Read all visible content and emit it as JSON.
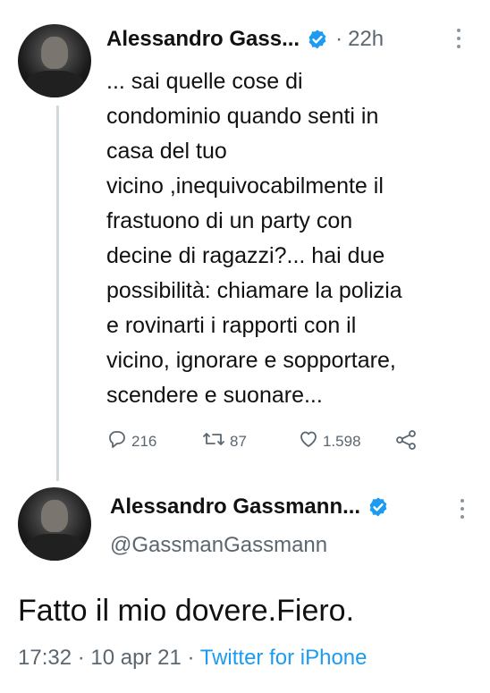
{
  "tweet1": {
    "author_name": "Alessandro Gass...",
    "time_ago": "22h",
    "separator": "·",
    "text": "... sai quelle cose di\ncondominio quando senti in\ncasa del tuo\nvicino ,inequivocabilmente il\nfrastuono di un party con\ndecine di ragazzi?... hai due\npossibilità: chiamare la polizia\ne rovinarti i rapporti con il\nvicino, ignorare e sopportare,\nscendere e suonare...",
    "replies": "216",
    "retweets": "87",
    "likes": "1.598",
    "icons": {
      "reply": "reply-icon",
      "retweet": "retweet-icon",
      "like": "heart-icon",
      "share": "share-icon",
      "more": "more-vertical-icon",
      "verified": "verified-badge-icon"
    }
  },
  "tweet2": {
    "author_name": "Alessandro Gassmann...",
    "handle": "@GassmanGassmann",
    "text": "Fatto il mio dovere.Fiero.",
    "time": "17:32",
    "date": "10 apr 21",
    "separator": "·",
    "source": "Twitter for iPhone"
  },
  "colors": {
    "accent": "#1d9bf0",
    "muted": "#5b6770",
    "thread_line": "#cfd9de"
  }
}
